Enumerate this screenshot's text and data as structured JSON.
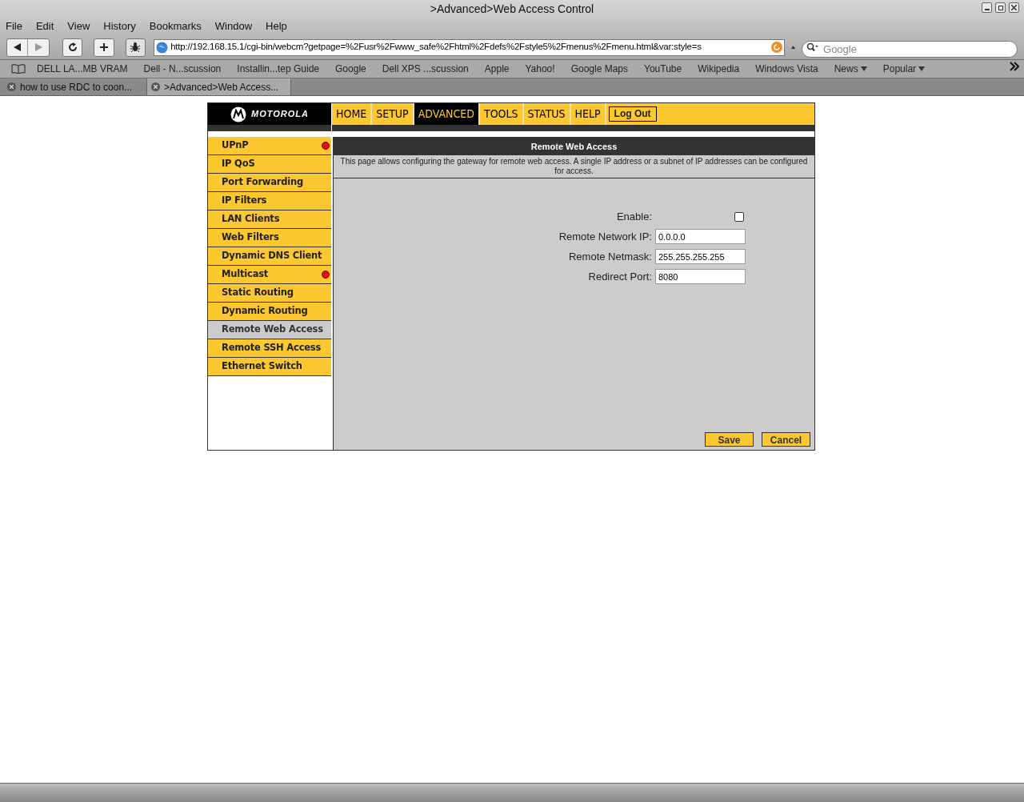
{
  "window": {
    "title": ">Advanced>Web Access Control"
  },
  "menu_bar": [
    "File",
    "Edit",
    "View",
    "History",
    "Bookmarks",
    "Window",
    "Help"
  ],
  "address_bar": {
    "value": "http://192.168.15.1/cgi-bin/webcm?getpage=%2Fusr%2Fwww_safe%2Fhtml%2Fdefs%2Fstyle5%2Fmenus%2Fmenu.html&var:style=s"
  },
  "search": {
    "placeholder": "Google"
  },
  "bookmarks": [
    {
      "label": "DELL LA...MB VRAM",
      "menu": false
    },
    {
      "label": "Dell - N...scussion",
      "menu": false
    },
    {
      "label": "Installin...tep Guide",
      "menu": false
    },
    {
      "label": "Google",
      "menu": false
    },
    {
      "label": "Dell XPS ...scussion",
      "menu": false
    },
    {
      "label": "Apple",
      "menu": false
    },
    {
      "label": "Yahoo!",
      "menu": false
    },
    {
      "label": "Google Maps",
      "menu": false
    },
    {
      "label": "YouTube",
      "menu": false
    },
    {
      "label": "Wikipedia",
      "menu": false
    },
    {
      "label": "Windows Vista",
      "menu": false
    },
    {
      "label": "News",
      "menu": true
    },
    {
      "label": "Popular",
      "menu": true
    }
  ],
  "tabs": [
    {
      "label": "how to use RDC to coon...",
      "selected": false
    },
    {
      "label": ">Advanced>Web Access...",
      "selected": true
    }
  ],
  "router": {
    "brand": "MOTOROLA",
    "nav": [
      {
        "label": "HOME",
        "selected": false
      },
      {
        "label": "SETUP",
        "selected": false
      },
      {
        "label": "ADVANCED",
        "selected": true
      },
      {
        "label": "TOOLS",
        "selected": false
      },
      {
        "label": "STATUS",
        "selected": false
      },
      {
        "label": "HELP",
        "selected": false
      }
    ],
    "logout": "Log Out",
    "sidebar": [
      {
        "label": "UPnP",
        "selected": false,
        "alert": true
      },
      {
        "label": "IP QoS",
        "selected": false,
        "alert": false
      },
      {
        "label": "Port Forwarding",
        "selected": false,
        "alert": false
      },
      {
        "label": "IP Filters",
        "selected": false,
        "alert": false
      },
      {
        "label": "LAN Clients",
        "selected": false,
        "alert": false
      },
      {
        "label": "Web Filters",
        "selected": false,
        "alert": false
      },
      {
        "label": "Dynamic DNS Client",
        "selected": false,
        "alert": false
      },
      {
        "label": "Multicast",
        "selected": false,
        "alert": true
      },
      {
        "label": "Static Routing",
        "selected": false,
        "alert": false
      },
      {
        "label": "Dynamic Routing",
        "selected": false,
        "alert": false
      },
      {
        "label": "Remote Web Access",
        "selected": true,
        "alert": false
      },
      {
        "label": "Remote SSH Access",
        "selected": false,
        "alert": false
      },
      {
        "label": "Ethernet Switch",
        "selected": false,
        "alert": false
      }
    ],
    "panel_title": "Remote Web Access",
    "description": "This page allows configuring the gateway for remote web access. A single IP address or a subnet of IP addresses can be configured for access.",
    "fields": [
      {
        "kind": "checkbox",
        "label": "Enable:",
        "checked": false
      },
      {
        "kind": "text",
        "label": "Remote Network IP:",
        "value": "0.0.0.0"
      },
      {
        "kind": "text",
        "label": "Remote Netmask:",
        "value": "255.255.255.255"
      },
      {
        "kind": "text",
        "label": "Redirect Port:",
        "value": "8080"
      }
    ],
    "buttons": [
      "Save",
      "Cancel"
    ]
  }
}
